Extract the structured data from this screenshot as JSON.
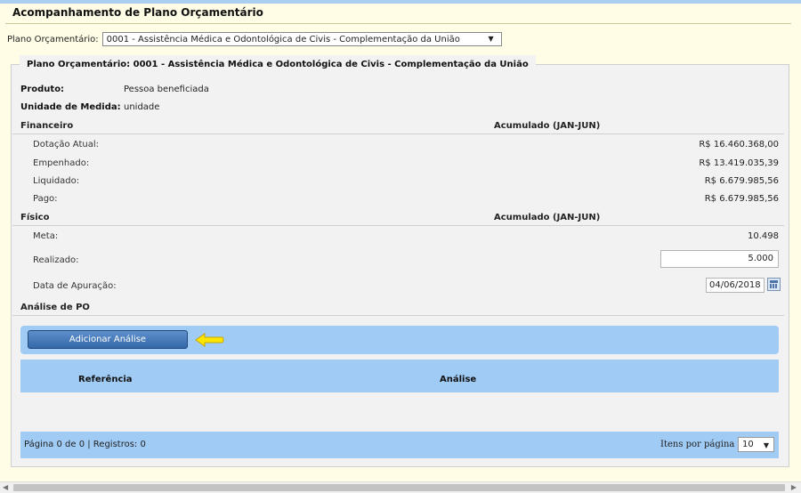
{
  "page": {
    "title": "Acompanhamento de Plano Orçamentário"
  },
  "plan_select": {
    "label": "Plano Orçamentário:",
    "value": "0001 - Assistência Médica e Odontológica de Civis - Complementação da União"
  },
  "fieldset": {
    "legend": "Plano Orçamentário: 0001 - Assistência Médica e Odontológica de Civis - Complementação da União"
  },
  "info": {
    "produto_label": "Produto:",
    "produto_value": "Pessoa beneficiada",
    "unidade_label": "Unidade de Medida:",
    "unidade_value": "unidade"
  },
  "financeiro": {
    "title": "Financeiro",
    "column": "Acumulado (JAN-JUN)",
    "rows": [
      {
        "label": "Dotação Atual:",
        "value": "R$ 16.460.368,00"
      },
      {
        "label": "Empenhado:",
        "value": "R$ 13.419.035,39"
      },
      {
        "label": "Liquidado:",
        "value": "R$ 6.679.985,56"
      },
      {
        "label": "Pago:",
        "value": "R$ 6.679.985,56"
      }
    ]
  },
  "fisico": {
    "title": "Físico",
    "column": "Acumulado (JAN-JUN)",
    "meta_label": "Meta:",
    "meta_value": "10.498",
    "realizado_label": "Realizado:",
    "realizado_value": "5.000",
    "data_label": "Data de Apuração:",
    "data_value": "04/06/2018"
  },
  "analise": {
    "title": "Análise de PO",
    "add_button": "Adicionar Análise",
    "columns": [
      "Referência",
      "Análise"
    ]
  },
  "pager": {
    "info": "Página 0 de 0 | Registros: 0",
    "items_label": "Itens por página",
    "items_value": "10"
  },
  "icons": {
    "arrow": "yellow-arrow-left-icon",
    "calendar": "calendar-icon"
  },
  "colors": {
    "background": "#fffde6",
    "panel": "#f2f2f2",
    "bar_blue": "#9fcbf5",
    "button_blue": "#3468a8",
    "arrow_yellow": "#ffe600"
  }
}
